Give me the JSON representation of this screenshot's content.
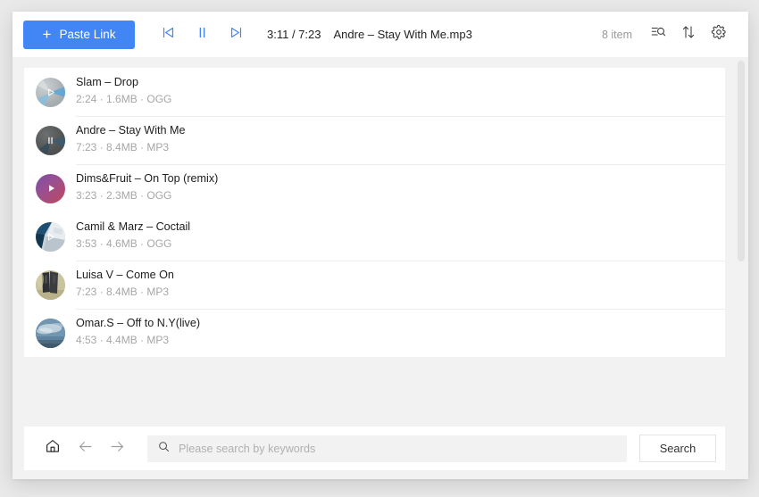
{
  "colors": {
    "accent": "#4285f4",
    "app_background": "#f2f2f2",
    "card": "#ffffff",
    "page_background": "#e9e9e9",
    "divider": "#ededed",
    "muted_text": "#a6a6a6",
    "primary_text": "#202020",
    "scrollbar_thumb": "#e2e2e2",
    "search_field_bg": "#f2f2f2"
  },
  "toolbar": {
    "paste_link_label": "Paste Link",
    "paste_link_icon": "plus-icon",
    "prev_icon": "skip-previous-icon",
    "pause_icon": "pause-icon",
    "next_icon": "skip-next-icon",
    "time_display": "3:11 / 7:23",
    "track_title": "Andre – Stay With Me.mp3",
    "item_count": "8 item",
    "filter_icon": "list-search-icon",
    "sort_icon": "sort-arrows-icon",
    "settings_icon": "gear-icon"
  },
  "list": {
    "tracks": [
      {
        "name": "Slam – Drop",
        "meta": "2:24 · 1.6MB · OGG",
        "duration": "2:24",
        "size": "1.6MB",
        "format": "OGG",
        "state_icon": "play-icon",
        "thumb": "disc-gray-blue"
      },
      {
        "name": "Andre – Stay With Me",
        "meta": "7:23 · 8.4MB · MP3",
        "duration": "7:23",
        "size": "8.4MB",
        "format": "MP3",
        "state_icon": "pause-icon",
        "thumb": "disc-dark"
      },
      {
        "name": "Dims&Fruit – On Top (remix)",
        "meta": "3:23 · 2.3MB · OGG",
        "duration": "3:23",
        "size": "2.3MB",
        "format": "OGG",
        "state_icon": "play-icon",
        "thumb": "gradient-purple-crimson"
      },
      {
        "name": "Camil & Marz – Coctail",
        "meta": "3:53 · 4.6MB · OGG",
        "duration": "3:53",
        "size": "4.6MB",
        "format": "OGG",
        "state_icon": "play-icon",
        "thumb": "photo-architecture"
      },
      {
        "name": "Luisa V – Come On",
        "meta": "7:23 · 8.4MB · MP3",
        "duration": "7:23",
        "size": "8.4MB",
        "format": "MP3",
        "state_icon": "none",
        "thumb": "photo-figures"
      },
      {
        "name": "Omar.S – Off to N.Y(live)",
        "meta": "4:53 · 4.4MB · MP3",
        "duration": "4:53",
        "size": "4.4MB",
        "format": "MP3",
        "state_icon": "none",
        "thumb": "photo-sky"
      }
    ]
  },
  "bottom_bar": {
    "home_icon": "home-icon",
    "back_icon": "arrow-left-icon",
    "forward_icon": "arrow-right-icon",
    "search_icon": "search-icon",
    "search_value": "",
    "search_placeholder": "Please search by keywords",
    "search_button_label": "Search"
  }
}
